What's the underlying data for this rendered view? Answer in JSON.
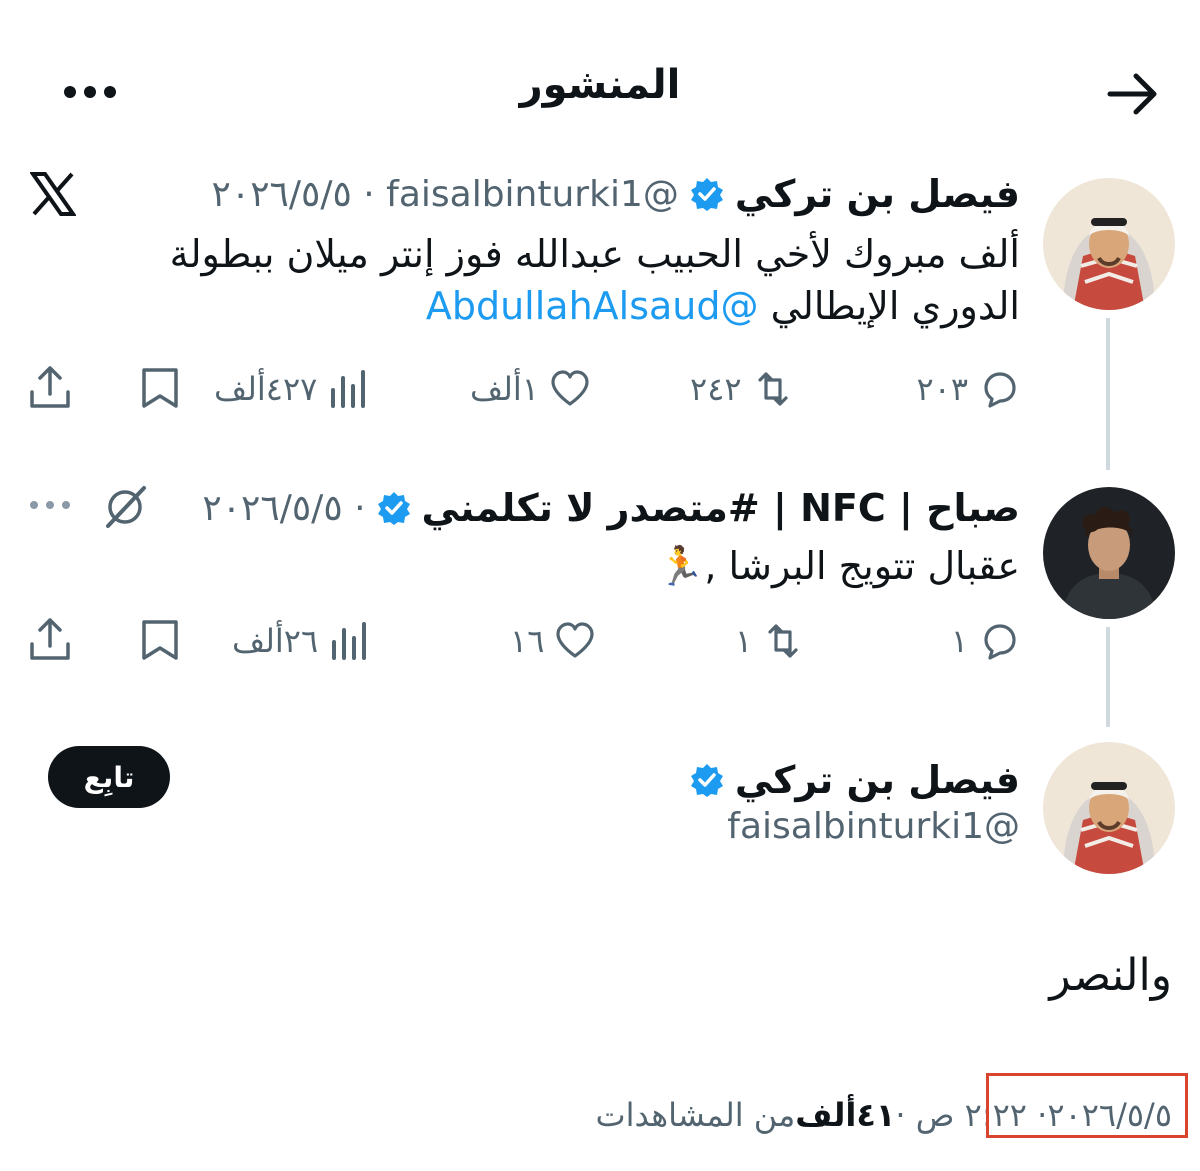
{
  "header": {
    "title": "المنشور"
  },
  "tweet1": {
    "name": "فيصل بن تركي",
    "handle_time": "@faisalbinturki1 · ٢٠٢٦/٥/٥",
    "body_line1": "ألف مبروك لأخي الحبيب عبدالله فوز إنتر ميلان ببطولة",
    "body_line2_text": "الدوري الإيطالي ",
    "mention": "@AbdullahAlsaud",
    "replies": "٢٠٣",
    "reposts": "٢٤٢",
    "likes": "١ألف",
    "views": "٤٢٧ألف"
  },
  "tweet2": {
    "name": "صباح | NFC | #متصدر لا تكلمني",
    "time": "· ٢٠٢٦/٥/٥",
    "body": "عقبال تتويج البرشا ,🏃",
    "replies": "١",
    "reposts": "١",
    "likes": "١٦",
    "views": "٢٦ألف"
  },
  "main_tweet": {
    "name": "فيصل بن تركي",
    "handle": "@faisalbinturki1",
    "follow_label": "تابِع",
    "text": "والنصر",
    "date": "٢٠٢٦/٥/٥",
    "time": " · ٢:٢٢ ص · ",
    "views_count": "٤١ألف",
    "views_label": " من المشاهدات"
  },
  "colors": {
    "verified": "#1d9bf0",
    "mention": "#1d9bf0",
    "highlight_box": "#d9442e"
  }
}
